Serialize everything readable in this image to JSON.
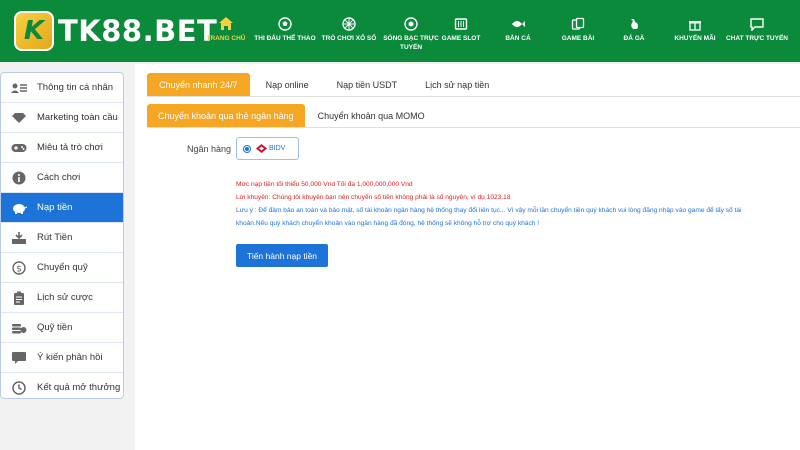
{
  "header": {
    "logo_mark": "K",
    "logo_text": "TK88.BET",
    "nav": [
      {
        "label": "TRANG CHỦ",
        "icon": "home-icon"
      },
      {
        "label": "THI ĐẤU THỂ THAO",
        "icon": "soccer-ball-icon"
      },
      {
        "label": "TRÒ CHƠI XỔ SỐ",
        "icon": "lottery-icon"
      },
      {
        "label": "SÒNG BẠC TRỰC TUYẾN",
        "icon": "casino-chip-icon"
      },
      {
        "label": "GAME SLOT",
        "icon": "slot-machine-icon"
      },
      {
        "label": "BẮN CÁ",
        "icon": "fish-icon"
      },
      {
        "label": "GAME BÀI",
        "icon": "cards-icon"
      },
      {
        "label": "ĐÁ GÀ",
        "icon": "rooster-icon"
      },
      {
        "label": "KHUYẾN MÃI",
        "icon": "gift-icon"
      },
      {
        "label": "CHAT TRỰC TUYẾN",
        "icon": "chat-icon"
      }
    ]
  },
  "sidebar": {
    "items": [
      {
        "label": "Thông tin cá nhân",
        "icon": "user-card-icon"
      },
      {
        "label": "Marketing toàn cầu",
        "icon": "diamond-icon"
      },
      {
        "label": "Miêu tả trò chơi",
        "icon": "gamepad-icon"
      },
      {
        "label": "Cách chơi",
        "icon": "info-icon"
      },
      {
        "label": "Nạp tiền",
        "icon": "piggy-bank-icon"
      },
      {
        "label": "Rút Tiền",
        "icon": "withdraw-icon"
      },
      {
        "label": "Chuyển quỹ",
        "icon": "transfer-coin-icon"
      },
      {
        "label": "Lịch sử cược",
        "icon": "clipboard-icon"
      },
      {
        "label": "Quỹ tiền",
        "icon": "coins-icon"
      },
      {
        "label": "Ý kiến phản hồi",
        "icon": "feedback-icon"
      },
      {
        "label": "Kết quả mở thưởng",
        "icon": "history-icon"
      }
    ]
  },
  "tabs_primary": [
    "Chuyển nhanh 24/7",
    "Nạp online",
    "Nạp tiền USDT",
    "Lịch sử nạp tiền"
  ],
  "tabs_secondary": [
    "Chuyển khoản qua thẻ ngân hàng",
    "Chuyển khoản qua MOMO"
  ],
  "form": {
    "bank_label": "Ngân hàng",
    "bank_option": "BIDV",
    "note_min_max": "Mức nạp tiền tối thiểu 50,000 Vnd Tối đa 1,000,000,000 Vnd",
    "note_advice": "Lời khuyên: Chúng tôi khuyên bạn nên chuyển số tiền không phải là số nguyên, ví dụ 1023.18",
    "note_warning": "Lưu ý : Để đảm bảo an toàn và bảo mật, số tài khoản ngân hàng hệ thống thay đổi liên tục... Vì vậy mỗi lần chuyển tiền quý khách vui lòng đăng nhập vào game để lấy số tài khoản.Nếu quý khách chuyển khoản vào ngân hàng đã đóng, hệ thống sẽ không hỗ trợ cho quý khách !",
    "submit_label": "Tiến hành nạp tiền"
  },
  "colors": {
    "header_green": "#0a8a3a",
    "accent_orange": "#f5a623",
    "primary_blue": "#1e73d8",
    "note_red": "#e02020",
    "active_nav": "#f5d142"
  }
}
